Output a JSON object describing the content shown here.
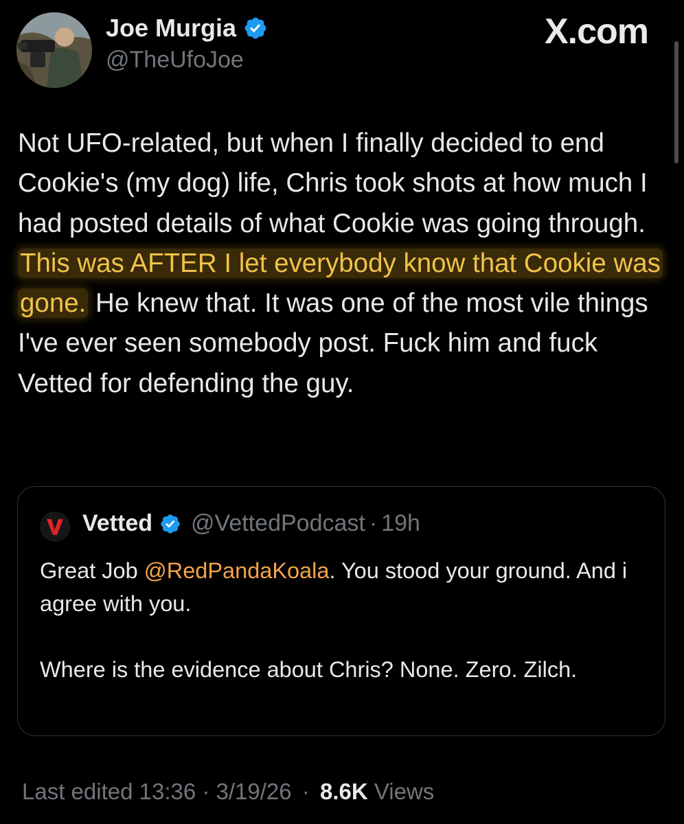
{
  "author": {
    "display_name": "Joe Murgia",
    "handle": "@TheUfoJoe",
    "verified": true
  },
  "brand": "X.com",
  "tweet": {
    "text_before": "Not UFO-related, but when I finally decided to end Cookie's (my dog) life, Chris took shots at how much I had posted details of what Cookie was going through. ",
    "text_highlight": "This was AFTER I let everybody know that Cookie was gone.",
    "text_after": " He knew that. It was one of the most vile things I've ever seen somebody post. Fuck him and fuck Vetted for defending the guy."
  },
  "quoted_tweet": {
    "display_name": "Vetted",
    "handle": "@VettedPodcast",
    "separator": "·",
    "time": "19h",
    "verified": true,
    "avatar_letter": "V",
    "para1_before": "Great Job ",
    "para1_mention": "@RedPandaKoala",
    "para1_after": ". You stood your ground. And i agree with you.",
    "para2": "Where is the evidence about Chris? None. Zero. Zilch."
  },
  "footer": {
    "edited_label": "Last edited 13:36 · 3/19/26",
    "separator": "·",
    "views_count": "8.6K",
    "views_label": "Views"
  },
  "colors": {
    "background": "#000000",
    "text": "#e7e9ea",
    "muted": "#71767b",
    "verified": "#1d9bf0",
    "highlight_text": "#f0c24a",
    "mention": "#f6a34a",
    "border": "#2f3336"
  },
  "icons": {
    "verified": "verified-badge-icon",
    "vetted_logo": "vetted-v-logo-icon"
  }
}
